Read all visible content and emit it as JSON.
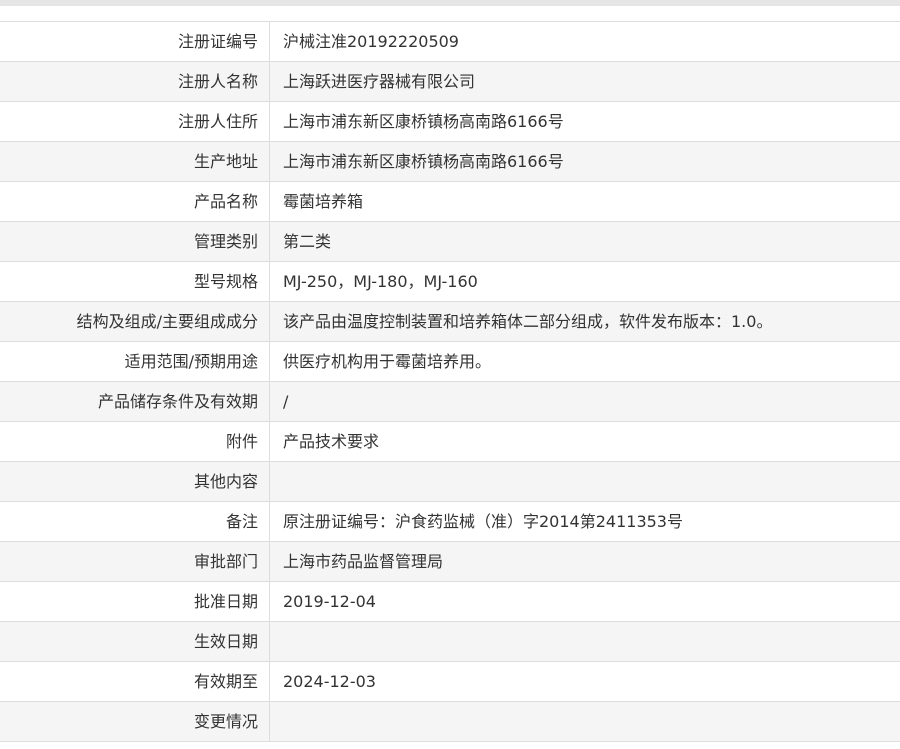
{
  "rows": [
    {
      "label": "注册证编号",
      "value": "沪械注准20192220509"
    },
    {
      "label": "注册人名称",
      "value": "上海跃进医疗器械有限公司"
    },
    {
      "label": "注册人住所",
      "value": "上海市浦东新区康桥镇杨高南路6166号"
    },
    {
      "label": "生产地址",
      "value": "上海市浦东新区康桥镇杨高南路6166号"
    },
    {
      "label": "产品名称",
      "value": "霉菌培养箱"
    },
    {
      "label": "管理类别",
      "value": "第二类"
    },
    {
      "label": "型号规格",
      "value": "MJ-250，MJ-180，MJ-160"
    },
    {
      "label": "结构及组成/主要组成成分",
      "value": "该产品由温度控制装置和培养箱体二部分组成，软件发布版本：1.0。"
    },
    {
      "label": "适用范围/预期用途",
      "value": "供医疗机构用于霉菌培养用。"
    },
    {
      "label": "产品储存条件及有效期",
      "value": "/"
    },
    {
      "label": "附件",
      "value": "产品技术要求"
    },
    {
      "label": "其他内容",
      "value": ""
    },
    {
      "label": "备注",
      "value": "原注册证编号：沪食药监械（准）字2014第2411353号"
    },
    {
      "label": "审批部门",
      "value": "上海市药品监督管理局"
    },
    {
      "label": "批准日期",
      "value": "2019-12-04"
    },
    {
      "label": "生效日期",
      "value": ""
    },
    {
      "label": "有效期至",
      "value": "2024-12-03"
    },
    {
      "label": "变更情况",
      "value": ""
    }
  ]
}
